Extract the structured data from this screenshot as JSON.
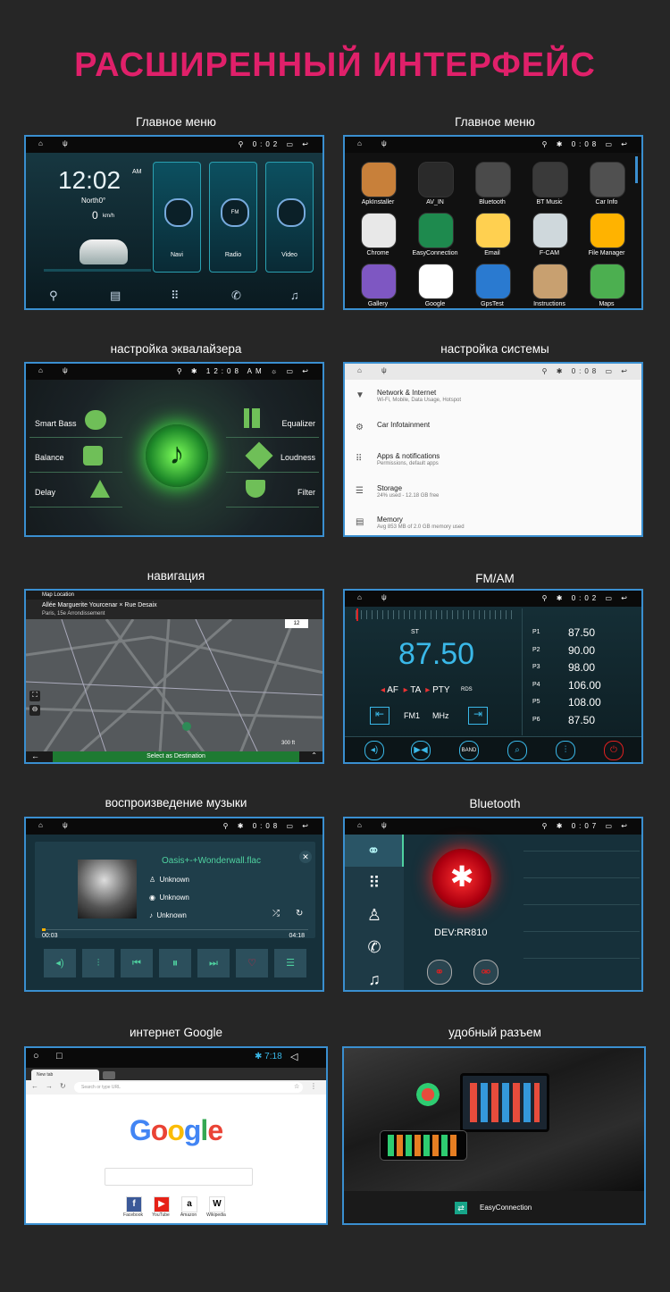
{
  "heading": "РАСШИРЕННЫЙ ИНТЕРФЕЙС",
  "captions": {
    "main_menu_1": "Главное меню",
    "main_menu_2": "Главное меню",
    "equalizer": "настройка эквалайзера",
    "system": "настройка системы",
    "navigation": "навигация",
    "fm": "FM/AM",
    "music": "воспроизведение музыки",
    "bluetooth": "Bluetooth",
    "internet": "интернет Google",
    "connector": "удобный разъем"
  },
  "home": {
    "time": "12:02",
    "ampm": "AM",
    "heading": "North0°",
    "speed": "0",
    "speed_unit": "km/h",
    "status_time": "0:02",
    "cards": [
      "Navi",
      "Radio",
      "Video"
    ]
  },
  "apps": {
    "status_time": "0:08",
    "list": [
      "ApkInstaller",
      "AV_IN",
      "Bluetooth",
      "BT Music",
      "Car Info",
      "Chrome",
      "EasyConnection",
      "Email",
      "F-CAM",
      "File Manager",
      "Gallery",
      "Google",
      "GpsTest",
      "Instructions",
      "Maps"
    ],
    "colors": [
      "#c8803a",
      "#2a2a2a",
      "#4a4a4a",
      "#3a3a3a",
      "#505050",
      "#e8e8e8",
      "#1e8a4e",
      "#ffd050",
      "#cfd8dc",
      "#ffb300",
      "#7e57c2",
      "#ffffff",
      "#2a7ad0",
      "#c8a070",
      "#4caf50"
    ]
  },
  "eq": {
    "status_time": "12:08 AM",
    "left": [
      "Smart Bass",
      "Balance",
      "Delay"
    ],
    "right": [
      "Equalizer",
      "Loudness",
      "Filter"
    ]
  },
  "settings": {
    "status_time": "0:08",
    "items": [
      {
        "title": "Network & Internet",
        "sub": "Wi-Fi, Mobile, Data Usage, Hotspot"
      },
      {
        "title": "Car Infotainment",
        "sub": ""
      },
      {
        "title": "Apps & notifications",
        "sub": "Permissions, default apps"
      },
      {
        "title": "Storage",
        "sub": "24% used - 12.18 GB free"
      },
      {
        "title": "Memory",
        "sub": "Avg 853 MB of 2.0 GB memory used"
      }
    ]
  },
  "map": {
    "header": "Map Location",
    "street": "Allée Marguerite Yourcenar × Rue Desaix",
    "district": "Paris, 15e Arrondissement",
    "scale": "300 ft",
    "zoom": "12",
    "button": "Select as Destination"
  },
  "radio": {
    "status_time": "0:02",
    "mode": "ST",
    "freq": "87.50",
    "flags": [
      "AF",
      "TA",
      "PTY"
    ],
    "rds": "RDS",
    "band": "FM1",
    "unit": "MHz",
    "presets": [
      {
        "p": "P1",
        "f": "87.50"
      },
      {
        "p": "P2",
        "f": "90.00"
      },
      {
        "p": "P3",
        "f": "98.00"
      },
      {
        "p": "P4",
        "f": "106.00"
      },
      {
        "p": "P5",
        "f": "108.00"
      },
      {
        "p": "P6",
        "f": "87.50"
      }
    ],
    "band_btn": "BAND"
  },
  "music": {
    "status_time": "0:08",
    "track": "Oasis+-+Wonderwall.flac",
    "artist": "Unknown",
    "album": "Unknown",
    "genre": "Unknown",
    "elapsed": "00:03",
    "total": "04:18",
    "progress": 0.012
  },
  "bt": {
    "status_time": "0:07",
    "device": "DEV:RR810"
  },
  "browser": {
    "status_time": "7:18",
    "tab": "New tab",
    "placeholder": "Search or type URL",
    "logo": "Google",
    "shortcuts": [
      "Facebook",
      "YouTube",
      "Amazon",
      "Wikipedia"
    ]
  },
  "connector": {
    "label": "EasyConnection"
  }
}
